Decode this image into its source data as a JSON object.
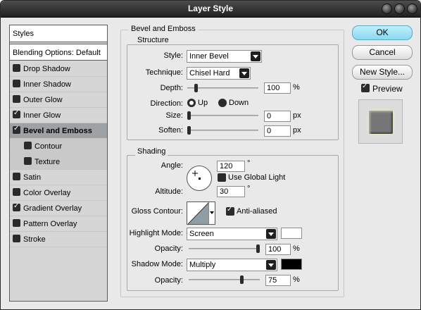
{
  "window": {
    "title": "Layer Style"
  },
  "styles_panel": {
    "header": "Styles",
    "blending": "Blending Options: Default",
    "items": [
      {
        "label": "Drop Shadow",
        "checked": false
      },
      {
        "label": "Inner Shadow",
        "checked": false
      },
      {
        "label": "Outer Glow",
        "checked": false
      },
      {
        "label": "Inner Glow",
        "checked": true
      },
      {
        "label": "Bevel and Emboss",
        "checked": true,
        "selected": true
      },
      {
        "label": "Contour",
        "checked": false,
        "sub": true
      },
      {
        "label": "Texture",
        "checked": false,
        "sub": true
      },
      {
        "label": "Satin",
        "checked": false
      },
      {
        "label": "Color Overlay",
        "checked": false
      },
      {
        "label": "Gradient Overlay",
        "checked": true
      },
      {
        "label": "Pattern Overlay",
        "checked": false
      },
      {
        "label": "Stroke",
        "checked": false
      }
    ]
  },
  "bevel": {
    "title": "Bevel and Emboss",
    "structure": {
      "title": "Structure",
      "style_label": "Style:",
      "style_value": "Inner Bevel",
      "technique_label": "Technique:",
      "technique_value": "Chisel Hard",
      "depth_label": "Depth:",
      "depth_value": "100",
      "depth_unit": "%",
      "direction_label": "Direction:",
      "direction_up": "Up",
      "direction_down": "Down",
      "size_label": "Size:",
      "size_value": "0",
      "size_unit": "px",
      "soften_label": "Soften:",
      "soften_value": "0",
      "soften_unit": "px"
    },
    "shading": {
      "title": "Shading",
      "angle_label": "Angle:",
      "angle_value": "120",
      "angle_unit": "°",
      "global_light_label": "Use Global Light",
      "altitude_label": "Altitude:",
      "altitude_value": "30",
      "altitude_unit": "°",
      "gloss_label": "Gloss Contour:",
      "anti_aliased_label": "Anti-aliased",
      "highlight_label": "Highlight Mode:",
      "highlight_value": "Screen",
      "highlight_color": "#ffffff",
      "highlight_opacity_label": "Opacity:",
      "highlight_opacity_value": "100",
      "highlight_opacity_unit": "%",
      "shadow_label": "Shadow Mode:",
      "shadow_value": "Multiply",
      "shadow_color": "#000000",
      "shadow_opacity_label": "Opacity:",
      "shadow_opacity_value": "75",
      "shadow_opacity_unit": "%"
    }
  },
  "buttons": {
    "ok": "OK",
    "cancel": "Cancel",
    "new_style": "New Style...",
    "preview": "Preview"
  },
  "colors": {
    "ok_accent": "#8ad9f0",
    "selected_row": "#9fa2a5",
    "preview_glow": "#f1f3a8"
  }
}
